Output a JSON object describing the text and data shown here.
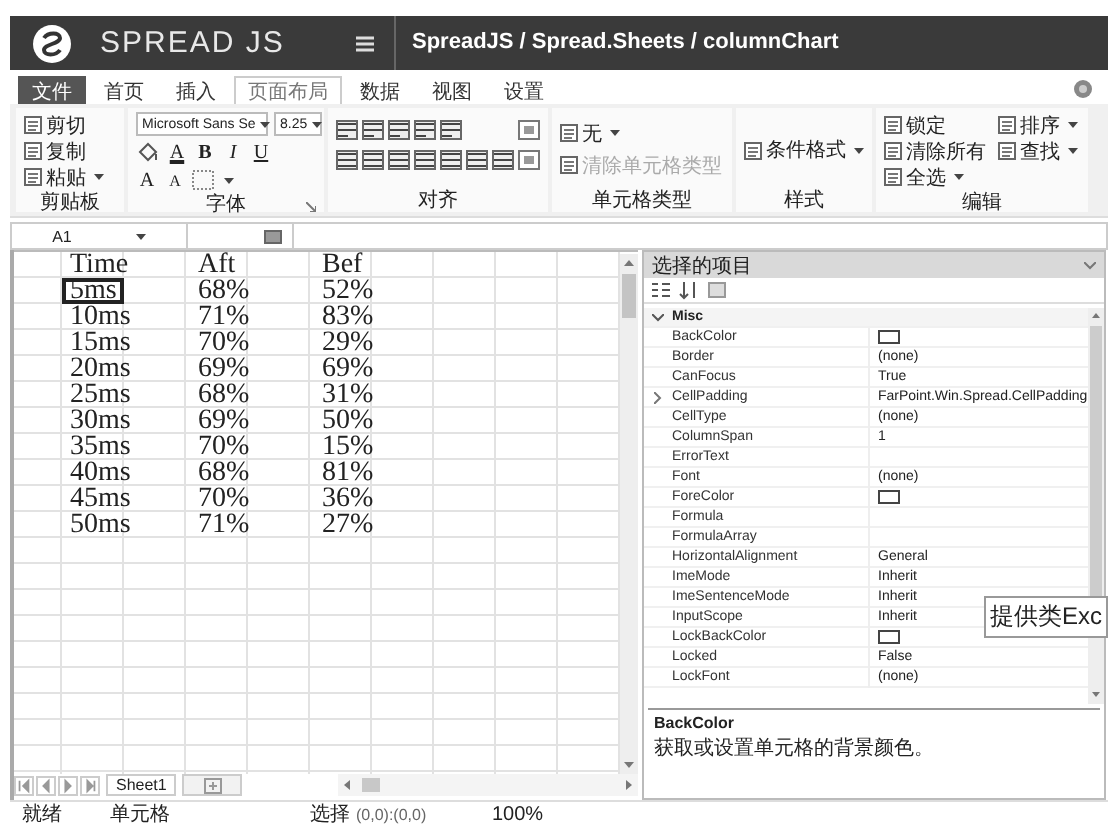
{
  "header": {
    "title": "SPREAD JS",
    "breadcrumb": "SpreadJS / Spread.Sheets / columnChart"
  },
  "tabs": [
    {
      "label": "文件",
      "kind": "file",
      "selected": false
    },
    {
      "label": "首页",
      "kind": "plain",
      "selected": false
    },
    {
      "label": "插入",
      "kind": "plain",
      "selected": false
    },
    {
      "label": "页面布局",
      "kind": "plain",
      "selected": true
    },
    {
      "label": "数据",
      "kind": "plain",
      "selected": false
    },
    {
      "label": "视图",
      "kind": "plain",
      "selected": false
    },
    {
      "label": "设置",
      "kind": "plain",
      "selected": false
    }
  ],
  "ribbon": {
    "groups": [
      {
        "label": "剪贴板",
        "kind": "items",
        "items": [
          {
            "label": "剪切",
            "dropdown": false
          },
          {
            "label": "复制",
            "dropdown": false
          },
          {
            "label": "粘贴",
            "dropdown": true
          }
        ]
      },
      {
        "label": "字体",
        "kind": "font",
        "font_name": "Microsoft Sans Se",
        "font_size": "8.25",
        "style_buttons": [
          {
            "label": "A",
            "kind": "color"
          },
          {
            "label": "B",
            "kind": "bold"
          },
          {
            "label": "I",
            "kind": "italic"
          },
          {
            "label": "U",
            "kind": "underline"
          }
        ],
        "size_buttons": [
          {
            "label": "A",
            "kind": "grow"
          },
          {
            "label": "A",
            "kind": "shrink"
          }
        ]
      },
      {
        "label": "对齐",
        "kind": "align"
      },
      {
        "label": "单元格类型",
        "kind": "items",
        "items": [
          {
            "label": "无",
            "dropdown": true,
            "disabled": false
          },
          {
            "label": "清除单元格类型",
            "dropdown": false,
            "disabled": true
          }
        ]
      },
      {
        "label": "样式",
        "kind": "items",
        "items": [
          {
            "label": "条件格式",
            "dropdown": true
          }
        ]
      },
      {
        "label": "编辑",
        "kind": "items",
        "items": [
          {
            "label": "锁定",
            "dropdown": false
          },
          {
            "label": "清除所有",
            "dropdown": false
          },
          {
            "label": "全选",
            "dropdown": true
          },
          {
            "label": "排序",
            "dropdown": true
          },
          {
            "label": "查找",
            "dropdown": true
          }
        ]
      }
    ]
  },
  "formula_bar": {
    "cell": "A1"
  },
  "sheet": {
    "rows": [
      {
        "cells": [
          {
            "text": "Time",
            "selected": false
          },
          {
            "text": "Aft",
            "selected": false
          },
          {
            "text": "Bef",
            "selected": false
          }
        ]
      },
      {
        "cells": [
          {
            "text": "5ms",
            "selected": true
          },
          {
            "text": "68%",
            "selected": false
          },
          {
            "text": "52%",
            "selected": false
          }
        ]
      },
      {
        "cells": [
          {
            "text": "10ms",
            "selected": false
          },
          {
            "text": "71%",
            "selected": false
          },
          {
            "text": "83%",
            "selected": false
          }
        ]
      },
      {
        "cells": [
          {
            "text": "15ms",
            "selected": false
          },
          {
            "text": "70%",
            "selected": false
          },
          {
            "text": "29%",
            "selected": false
          }
        ]
      },
      {
        "cells": [
          {
            "text": "20ms",
            "selected": false
          },
          {
            "text": "69%",
            "selected": false
          },
          {
            "text": "69%",
            "selected": false
          }
        ]
      },
      {
        "cells": [
          {
            "text": "25ms",
            "selected": false
          },
          {
            "text": "68%",
            "selected": false
          },
          {
            "text": "31%",
            "selected": false
          }
        ]
      },
      {
        "cells": [
          {
            "text": "30ms",
            "selected": false
          },
          {
            "text": "69%",
            "selected": false
          },
          {
            "text": "50%",
            "selected": false
          }
        ]
      },
      {
        "cells": [
          {
            "text": "35ms",
            "selected": false
          },
          {
            "text": "70%",
            "selected": false
          },
          {
            "text": "15%",
            "selected": false
          }
        ]
      },
      {
        "cells": [
          {
            "text": "40ms",
            "selected": false
          },
          {
            "text": "68%",
            "selected": false
          },
          {
            "text": "81%",
            "selected": false
          }
        ]
      },
      {
        "cells": [
          {
            "text": "45ms",
            "selected": false
          },
          {
            "text": "70%",
            "selected": false
          },
          {
            "text": "36%",
            "selected": false
          }
        ]
      },
      {
        "cells": [
          {
            "text": "50ms",
            "selected": false
          },
          {
            "text": "71%",
            "selected": false
          },
          {
            "text": "27%",
            "selected": false
          }
        ]
      }
    ],
    "sheet_tabs": [
      {
        "label": "Sheet1",
        "selected": true
      }
    ]
  },
  "panel": {
    "title": "选择的项目",
    "category": "Misc",
    "properties": [
      {
        "name": "BackColor",
        "kind": "color"
      },
      {
        "name": "Border",
        "kind": "text",
        "value": "(none)"
      },
      {
        "name": "CanFocus",
        "kind": "text",
        "value": "True"
      },
      {
        "name": "CellPadding",
        "kind": "group",
        "value": "FarPoint.Win.Spread.CellPadding"
      },
      {
        "name": "CellType",
        "kind": "text",
        "value": "(none)"
      },
      {
        "name": "ColumnSpan",
        "kind": "text",
        "value": "1"
      },
      {
        "name": "ErrorText",
        "kind": "text"
      },
      {
        "name": "Font",
        "kind": "text",
        "value": "(none)"
      },
      {
        "name": "ForeColor",
        "kind": "color"
      },
      {
        "name": "Formula",
        "kind": "text"
      },
      {
        "name": "FormulaArray",
        "kind": "text"
      },
      {
        "name": "HorizontalAlignment",
        "kind": "text",
        "value": "General"
      },
      {
        "name": "ImeMode",
        "kind": "text",
        "value": "Inherit"
      },
      {
        "name": "ImeSentenceMode",
        "kind": "text",
        "value": "Inherit"
      },
      {
        "name": "InputScope",
        "kind": "text",
        "value": "Inherit"
      },
      {
        "name": "LockBackColor",
        "kind": "color"
      },
      {
        "name": "Locked",
        "kind": "text",
        "value": "False"
      },
      {
        "name": "LockFont",
        "kind": "text",
        "value": "(none)"
      }
    ],
    "description": {
      "title": "BackColor",
      "text": "获取或设置单元格的背景颜色。"
    }
  },
  "tooltip": "提供类Exc",
  "status_bar": {
    "state": "就绪",
    "mode": "单元格",
    "selection_label": "选择",
    "selection": "(0,0):(0,0)",
    "zoom": "100%"
  }
}
